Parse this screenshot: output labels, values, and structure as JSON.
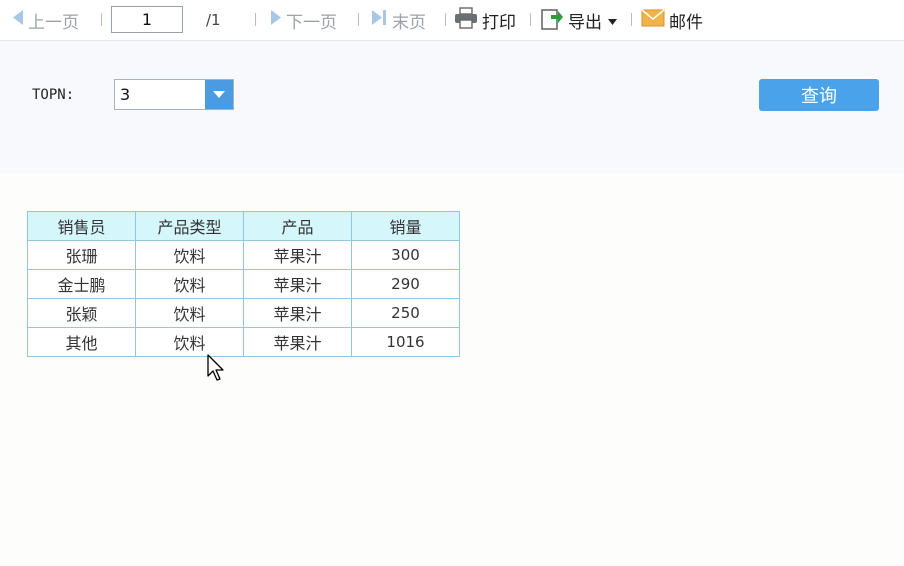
{
  "toolbar": {
    "prev_label": "上一页",
    "page_value": "1",
    "total_pages": "/1",
    "next_label": "下一页",
    "last_label": "末页",
    "print_label": "打印",
    "export_label": "导出",
    "mail_label": "邮件",
    "icons": [
      "prev-arrow-icon",
      "next-arrow-icon",
      "last-page-icon",
      "printer-icon",
      "export-icon",
      "dropdown-caret-icon",
      "mail-icon"
    ]
  },
  "params": {
    "topn_label": "TOPN:",
    "topn_value": "3",
    "query_label": "查询"
  },
  "table": {
    "headers": [
      "销售员",
      "产品类型",
      "产品",
      "销量"
    ],
    "rows": [
      [
        "张珊",
        "饮料",
        "苹果汁",
        "300"
      ],
      [
        "金士鹏",
        "饮料",
        "苹果汁",
        "290"
      ],
      [
        "张颖",
        "饮料",
        "苹果汁",
        "250"
      ],
      [
        "其他",
        "饮料",
        "苹果汁",
        "1016"
      ]
    ]
  },
  "colors": {
    "accent": "#4aa3ea",
    "header_bg": "#d5f7fb",
    "grid_border": "#94c6e2"
  }
}
